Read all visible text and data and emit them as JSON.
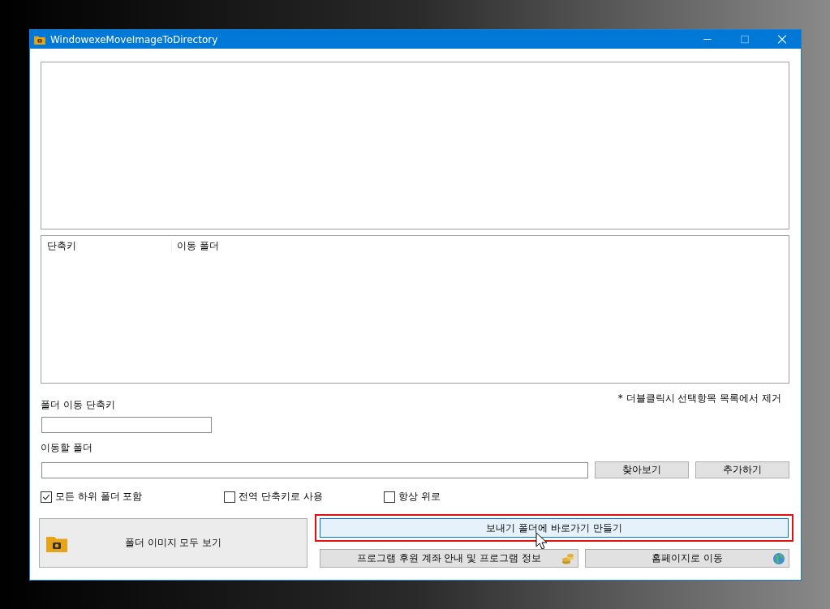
{
  "window": {
    "title": "WindowexeMoveImageToDirectory"
  },
  "shortcut_list": {
    "columns": [
      "단축키",
      "이동 폴더"
    ]
  },
  "hint": "* 더블클릭시 선택항목 목록에서 제거",
  "shortcut_field": {
    "label": "폴더 이동 단축키"
  },
  "folder_field": {
    "label": "이동할 폴더"
  },
  "folder_buttons": [
    "찾아보기",
    "추가하기"
  ],
  "options": [
    {
      "label": "모든 하위 폴더 포함",
      "checked": true
    },
    {
      "label": "전역 단축키로 사용",
      "checked": false
    },
    {
      "label": "항상 위로",
      "checked": false
    }
  ],
  "view_all_button": "폴더 이미지 모두 보기",
  "sendto_button": {
    "label": "보내기 폴더에 바로가기 만들기",
    "highlighted": true
  },
  "donate_button": "프로그램 후원 계좌 안내 및 프로그램 정보",
  "homepage_button": "홈페이지로 이동"
}
